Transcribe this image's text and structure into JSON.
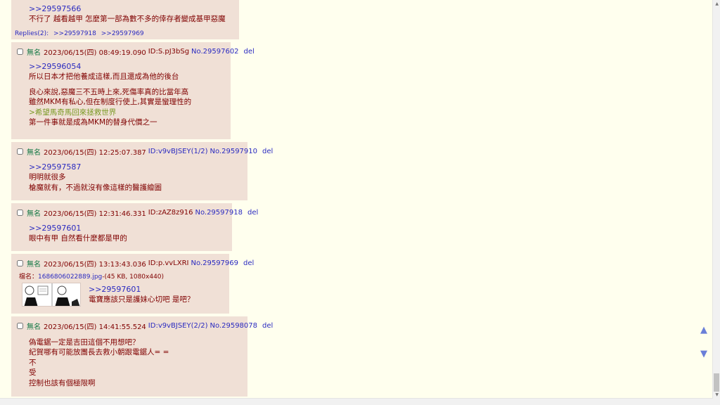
{
  "post0": {
    "ref": ">>29597566",
    "lines": [
      "不行了 越看越甲 怎麼第一部為數不多的倖存者變成基甲惡魔"
    ],
    "replies_label": "Replies(2):",
    "replies": [
      ">>29597918",
      ">>29597969"
    ]
  },
  "posts": [
    {
      "name": "無名",
      "date": "2023/06/15(四) 08:49:19.090",
      "id": "ID:S.pJ3bSg",
      "no": "No.29597602",
      "del": "del",
      "ref": ">>29596054",
      "lines": [
        "所以日本才把他養成這樣,而且還成為他的後台"
      ],
      "lines2": [
        "良心來說,惡魔三不五時上來,死傷率真的比當年高",
        "雖然MKM有私心,但在制度行使上,其實是蠻理性的"
      ],
      "quote": ">希望馬奇馬回來拯救世界",
      "lines3": [
        "第一件事就是成為MKM的替身代價之一"
      ]
    },
    {
      "name": "無名",
      "date": "2023/06/15(四) 12:25:07.387",
      "id": "ID:v9vBJSEY(1/2)",
      "no": "No.29597910",
      "del": "del",
      "ref": ">>29597587",
      "lines": [
        "明明就很多",
        "槍魔就有，不過就沒有像這樣的醫護繪圖"
      ]
    },
    {
      "name": "無名",
      "date": "2023/06/15(四) 12:31:46.331",
      "id": "ID:zAZ8z916",
      "no": "No.29597918",
      "del": "del",
      "ref": ">>29597601",
      "lines": [
        "眼中有甲 自然看什麼都是甲的"
      ]
    },
    {
      "name": "無名",
      "date": "2023/06/15(四) 13:13:43.036",
      "id": "ID:p.vvLXRI",
      "no": "No.29597969",
      "del": "del",
      "file_label": "檔名：",
      "file_name": "1686806022889.jpg",
      "file_meta": "-(45 KB, 1080x440)",
      "ref": ">>29597601",
      "lines": [
        "電寶應該只是護妹心切吧 是吧？"
      ]
    },
    {
      "name": "無名",
      "date": "2023/06/15(四) 14:41:55.524",
      "id": "ID:v9vBJSEY(2/2)",
      "no": "No.29598078",
      "del": "del",
      "lines": [
        "偽電鋸一定是吉田這個不用想吧？",
        "紀賀哪有可能放團長去救小朝跟電鋸人= =",
        "不",
        "受",
        "控制也該有個極限啊"
      ]
    }
  ],
  "nav": {
    "up": "▲",
    "down": "▼"
  },
  "colors": {
    "background": "#ffffee",
    "post_bg": "#f0e0d6",
    "name": "#117743",
    "link": "#2a2ac0",
    "text": "#800000",
    "quote": "#789922"
  }
}
